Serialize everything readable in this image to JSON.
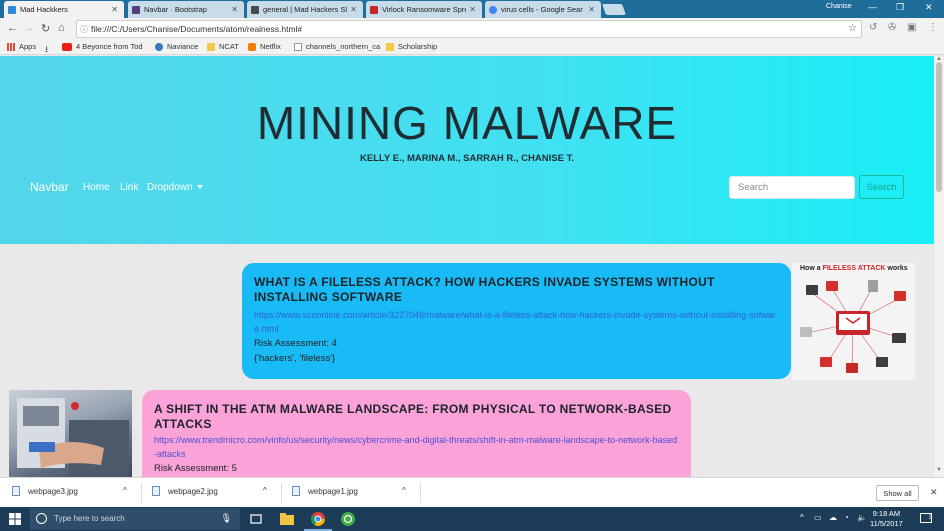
{
  "browser": {
    "tabs": [
      {
        "title": "Mad Hackkers",
        "active": true,
        "favicon_color": "#2b8bd6"
      },
      {
        "title": "Navbar · Bootstrap",
        "active": false,
        "favicon_color": "#563d7c"
      },
      {
        "title": "general | Mad Hackers Sl",
        "active": false,
        "favicon_color": "#4a4a4a"
      },
      {
        "title": "Virlock Ransomware Spre",
        "active": false,
        "favicon_color": "#c62828"
      },
      {
        "title": "virus cells - Google Sear",
        "active": false,
        "favicon_color": "#4285f4"
      }
    ],
    "user_name": "Chanise",
    "url": "file:///C:/Users/Chanise/Documents/atom/realness.html#",
    "bookmarks": [
      {
        "label": "Apps",
        "icon": "apps-grid-icon",
        "color": "#e04a3a"
      },
      {
        "label": "",
        "icon": "download-icon",
        "color": "#555"
      },
      {
        "label": "4 Beyonce from Tod",
        "icon": "youtube-icon",
        "color": "#e62117"
      },
      {
        "label": "Naviance",
        "icon": "naviance-icon",
        "color": "#3a78c2"
      },
      {
        "label": "NCAT",
        "icon": "folder-icon",
        "color": "#f2c94c"
      },
      {
        "label": "Netflix",
        "icon": "blogger-icon",
        "color": "#f57d00"
      },
      {
        "label": "channels_northern_ca",
        "icon": "page-icon",
        "color": "#999"
      },
      {
        "label": "Scholarship",
        "icon": "folder-icon",
        "color": "#f2c94c"
      }
    ]
  },
  "page": {
    "hero": {
      "title": "MINING MALWARE",
      "authors": "KELLY E., MARINA M., SARRAH R., CHANISE T."
    },
    "navbar": {
      "brand": "Navbar",
      "links": [
        "Home",
        "Link",
        "Dropdown"
      ],
      "search_placeholder": "Search",
      "search_button": "Search"
    },
    "articles": [
      {
        "title": "WHAT IS A FILELESS ATTACK? HOW HACKERS INVADE SYSTEMS WITHOUT INSTALLING SOFTWARE",
        "url": "https://www.scoonline.com/article/3227046/malware/what-is-a-fileless-attack-how-hackers-invade-systems-without-installing-sofware.html",
        "risk": "Risk Assessment: 4",
        "tags": "{'hackers', 'fileless'}",
        "color": "#18bbf6",
        "image_caption_prefix": "How a ",
        "image_caption_emphasis": "FILELESS ATTACK",
        "image_caption_suffix": " works"
      },
      {
        "title": "A SHIFT IN THE ATM MALWARE LANDSCAPE: FROM PHYSICAL TO NETWORK-BASED ATTACKS",
        "url": "https://www.trendmicro.com/vinfo/us/security/news/cybercrime-and-digital-threats/shift-in-atm-malware-landscape-to-network-based-attacks",
        "risk": "Risk Assessment: 5",
        "color": "#fba3d8"
      }
    ]
  },
  "downloads": {
    "files": [
      "webpage3.jpg",
      "webpage2.jpg",
      "webpage1.jpg"
    ],
    "show_all": "Show all"
  },
  "taskbar": {
    "search_placeholder": "Type here to search",
    "time": "9:18 AM",
    "date": "11/5/2017",
    "notifications": "3"
  }
}
